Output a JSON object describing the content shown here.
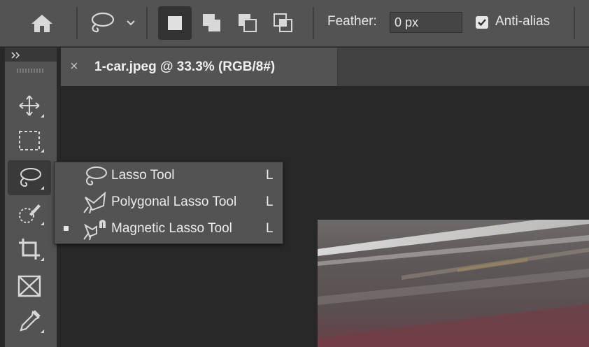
{
  "options_bar": {
    "feather_label": "Feather:",
    "feather_value": "0 px",
    "anti_alias_label": "Anti-alias",
    "anti_alias_checked": true,
    "selection_modes": [
      "new-selection",
      "add-to-selection",
      "subtract-from-selection",
      "intersect-with-selection"
    ],
    "active_mode": "new-selection"
  },
  "toolbar": {
    "tools": [
      "move-tool",
      "rectangular-marquee-tool",
      "lasso-tool",
      "quick-selection-tool",
      "crop-tool",
      "frame-tool",
      "eyedropper-tool"
    ],
    "active_tool": "lasso-tool"
  },
  "document_tab": {
    "close_glyph": "×",
    "title": "1-car.jpeg @ 33.3% (RGB/8#)"
  },
  "flyout": {
    "items": [
      {
        "label": "Lasso Tool",
        "shortcut": "L",
        "icon": "lasso-icon",
        "selected": false
      },
      {
        "label": "Polygonal Lasso Tool",
        "shortcut": "L",
        "icon": "polygonal-lasso-icon",
        "selected": false
      },
      {
        "label": "Magnetic Lasso Tool",
        "shortcut": "L",
        "icon": "magnetic-lasso-icon",
        "selected": true
      }
    ]
  },
  "colors": {
    "panel": "#535353",
    "background": "#282828",
    "text": "#e6e6e6"
  }
}
